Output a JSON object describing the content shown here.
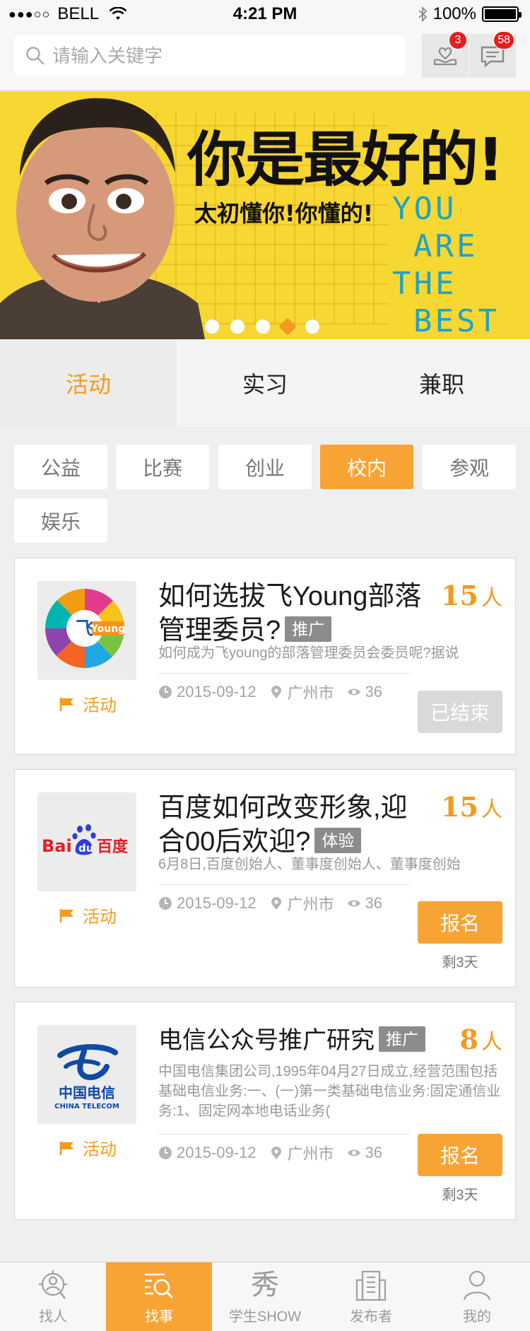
{
  "status_bar": {
    "signal": "●●●○○",
    "carrier": "BELL",
    "time": "4:21 PM",
    "battery": "100%"
  },
  "search": {
    "placeholder": "请输入关键字",
    "value": ""
  },
  "header": {
    "like_badge": "3",
    "message_badge": "58"
  },
  "banner": {
    "headline": "你是最好的!",
    "subline": "太初懂你!你懂的!",
    "english": [
      "YOU",
      "ARE",
      "THE",
      "BEST"
    ],
    "slide_count": 5,
    "active_slide": 4
  },
  "main_tabs": [
    {
      "label": "活动",
      "active": true
    },
    {
      "label": "实习",
      "active": false
    },
    {
      "label": "兼职",
      "active": false
    }
  ],
  "filters": [
    {
      "label": "公益",
      "active": false
    },
    {
      "label": "比赛",
      "active": false
    },
    {
      "label": "创业",
      "active": false
    },
    {
      "label": "校内",
      "active": true
    },
    {
      "label": "参观",
      "active": false
    },
    {
      "label": "娱乐",
      "active": false
    }
  ],
  "cards": [
    {
      "logo": "feiyoung-logo",
      "logo_text": "Young",
      "logo_char": "飞",
      "type": "活动",
      "title": "如何选拔飞Young部落管理委员?",
      "tag": "推广",
      "count": "15",
      "count_unit": "人",
      "desc": "如何成为飞young的部落管理委员会委员呢?据说",
      "date": "2015-09-12",
      "city": "广州市",
      "views": "36",
      "action": "已结束",
      "remaining": ""
    },
    {
      "logo": "baidu-logo",
      "logo_text": "Bai",
      "logo_text2": "du",
      "logo_text3": "百度",
      "type": "活动",
      "title": "百度如何改变形象,迎合00后欢迎?",
      "tag": "体验",
      "count": "15",
      "count_unit": "人",
      "desc": "6月8日,百度创始人、董事度创始人、董事度创始",
      "date": "2015-09-12",
      "city": "广州市",
      "views": "36",
      "action": "报名",
      "remaining": "剩3天"
    },
    {
      "logo": "china-telecom-logo",
      "logo_text": "中国电信",
      "logo_text2": "CHINA TELECOM",
      "type": "活动",
      "title": "电信公众号推广研究",
      "tag": "推广",
      "count": "8",
      "count_unit": "人",
      "desc": "中国电信集团公司,1995年04月27日成立,经营范围包括基础电信业务:一、(一)第一类基础电信业务:固定通信业务:1、固定网本地电话业务(",
      "date": "2015-09-12",
      "city": "广州市",
      "views": "36",
      "action": "报名",
      "remaining": "剩3天"
    }
  ],
  "bottom_nav": [
    {
      "label": "找人",
      "icon": "find-person-icon",
      "active": false
    },
    {
      "label": "找事",
      "icon": "find-task-icon",
      "active": true
    },
    {
      "label": "学生SHOW",
      "icon": "show-icon",
      "glyph": "秀",
      "active": false
    },
    {
      "label": "发布者",
      "icon": "publisher-building-icon",
      "active": false
    },
    {
      "label": "我的",
      "icon": "profile-icon",
      "active": false
    }
  ],
  "colors": {
    "accent": "#f8a435",
    "accent_text": "#f39a1f",
    "badge": "#e41e1e",
    "tag": "#8c8c8c"
  }
}
